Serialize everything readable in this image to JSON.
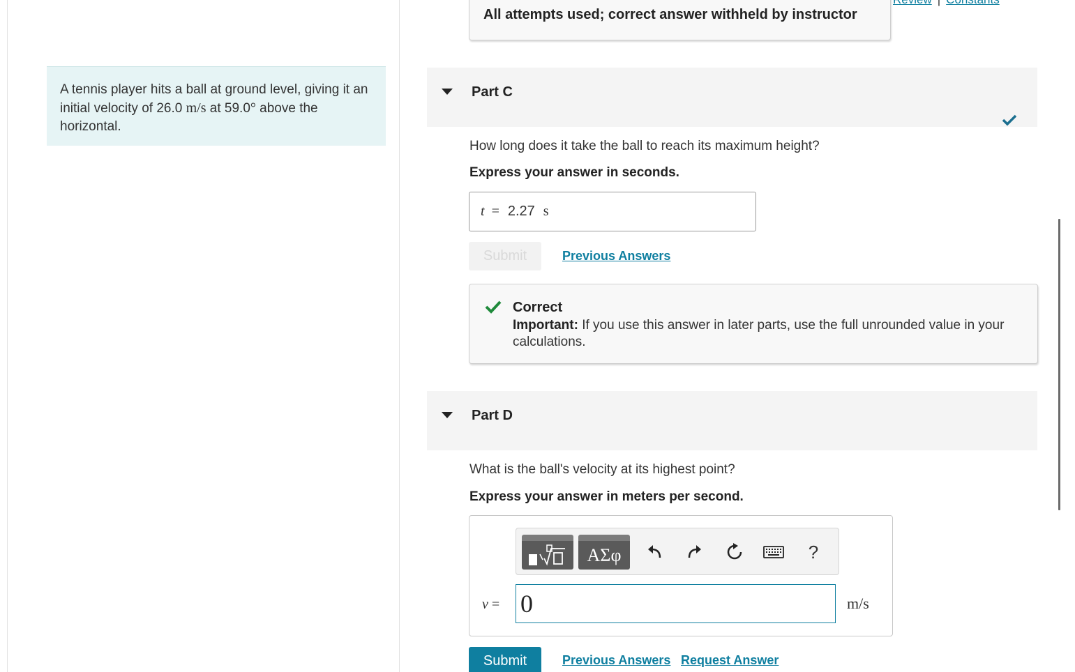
{
  "top_links": {
    "review": "Review",
    "constants": "Constants"
  },
  "problem": {
    "text_before": "A tennis player hits a ball at ground level, giving it an initial velocity of 26.0 ",
    "unit_mps": "m/s",
    "text_mid": " at 59.0",
    "degree": "°",
    "text_after": " above the horizontal."
  },
  "previous_part": {
    "status": "All attempts used; correct answer withheld by instructor"
  },
  "part_c": {
    "title": "Part C",
    "question": "How long does it take the ball to reach its maximum height?",
    "instruction": "Express your answer in seconds.",
    "variable": "t",
    "equals": "=",
    "answer_value": "2.27",
    "answer_unit": "s",
    "submit_label": "Submit",
    "previous_answers_label": "Previous Answers",
    "feedback_title": "Correct",
    "feedback_important_label": "Important:",
    "feedback_message": " If you use this answer in later parts, use the full unrounded value in your calculations."
  },
  "part_d": {
    "title": "Part D",
    "question": "What is the ball's velocity at its highest point?",
    "instruction": "Express your answer in meters per second.",
    "variable": "v",
    "equals": "=",
    "input_value": "0",
    "unit": "m/s",
    "toolbar": {
      "greek_label": "ΑΣφ",
      "help_label": "?"
    },
    "submit_label": "Submit",
    "previous_answers_label": "Previous Answers",
    "request_answer_label": "Request Answer"
  },
  "colors": {
    "accent": "#0f7fa0",
    "correct_green": "#1f8a3b",
    "problem_bg": "#e6f4f5",
    "check_teal": "#1a6e8f"
  },
  "icons": [
    "templates-icon",
    "greek-icon",
    "undo-icon",
    "redo-icon",
    "reset-icon",
    "keyboard-icon",
    "help-icon",
    "checkmark-icon",
    "collapse-triangle-icon"
  ]
}
